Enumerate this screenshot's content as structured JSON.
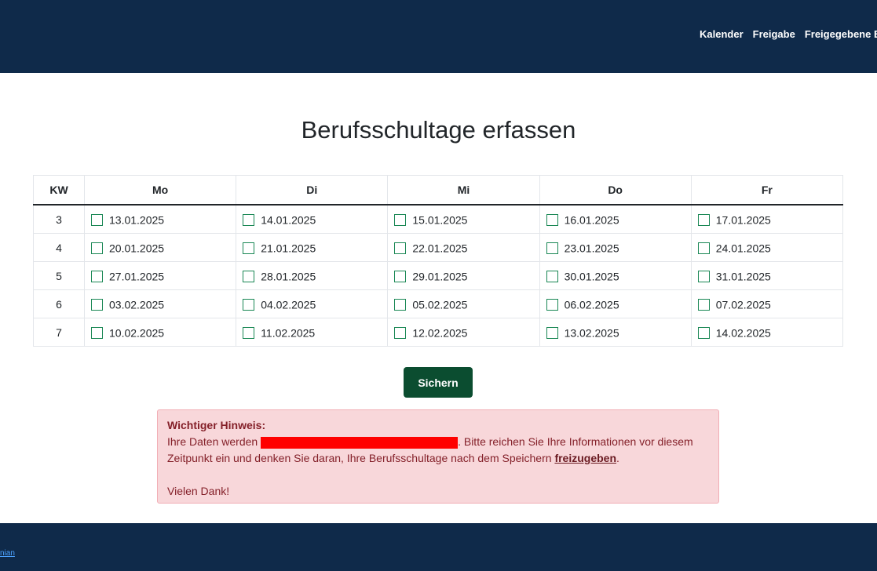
{
  "nav": {
    "items": [
      "Kalender",
      "Freigabe",
      "Freigegebene Einträge"
    ]
  },
  "page": {
    "title": "Berufsschultage erfassen"
  },
  "table": {
    "headers": [
      "KW",
      "Mo",
      "Di",
      "Mi",
      "Do",
      "Fr"
    ],
    "rows": [
      {
        "kw": "3",
        "days": [
          "13.01.2025",
          "14.01.2025",
          "15.01.2025",
          "16.01.2025",
          "17.01.2025"
        ]
      },
      {
        "kw": "4",
        "days": [
          "20.01.2025",
          "21.01.2025",
          "22.01.2025",
          "23.01.2025",
          "24.01.2025"
        ]
      },
      {
        "kw": "5",
        "days": [
          "27.01.2025",
          "28.01.2025",
          "29.01.2025",
          "30.01.2025",
          "31.01.2025"
        ]
      },
      {
        "kw": "6",
        "days": [
          "03.02.2025",
          "04.02.2025",
          "05.02.2025",
          "06.02.2025",
          "07.02.2025"
        ]
      },
      {
        "kw": "7",
        "days": [
          "10.02.2025",
          "11.02.2025",
          "12.02.2025",
          "13.02.2025",
          "14.02.2025"
        ]
      }
    ]
  },
  "actions": {
    "save_label": "Sichern"
  },
  "notice": {
    "heading": "Wichtiger Hinweis:",
    "text_before": "Ihre Daten werden ",
    "text_after": ". Bitte reichen Sie Ihre Informationen vor diesem Zeitpunkt ein und denken Sie daran, Ihre Berufsschultage nach dem Speichern ",
    "link_label": "freizugeben",
    "text_end": ".",
    "thanks": "Vielen Dank!"
  },
  "footer": {
    "link_label": "nian"
  },
  "colors": {
    "header_bg": "#0f2a4a",
    "save_button": "#0b4d30",
    "checkbox_border": "#198754",
    "alert_bg": "#f8d7da",
    "alert_text": "#842029",
    "redaction": "#ff0000"
  }
}
